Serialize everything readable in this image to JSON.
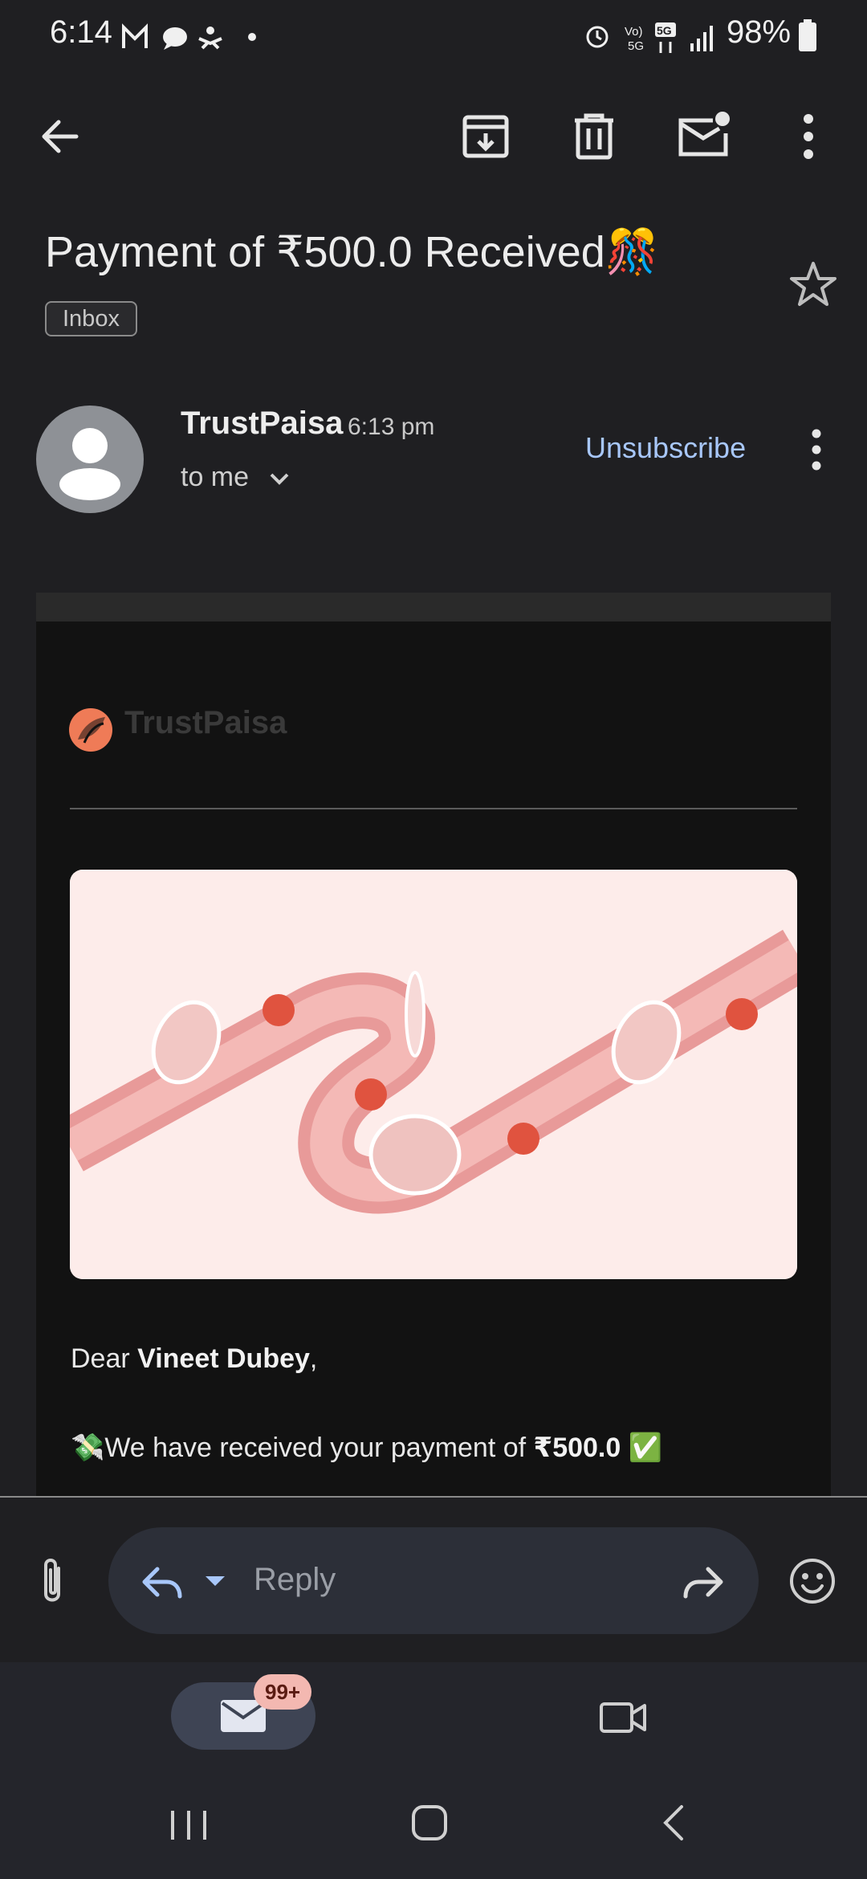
{
  "status_bar": {
    "time": "6:14",
    "battery": "98%"
  },
  "email": {
    "subject": "Payment of ₹500.0 Received🎊",
    "label": "Inbox",
    "sender": "TrustPaisa",
    "time": "6:13 pm",
    "recipient": "to me",
    "unsubscribe": "Unsubscribe",
    "brand": "TrustPaisa",
    "greeting_prefix": "Dear ",
    "customer_name": "Vineet Dubey",
    "greeting_suffix": ",",
    "payment_prefix": "💸We have received your payment of ",
    "payment_amount": "₹500.0",
    "payment_suffix": " ✅"
  },
  "reply_bar": {
    "placeholder": "Reply"
  },
  "bottom_nav": {
    "mail_badge": "99+"
  },
  "colors": {
    "accent": "#a8c7fa",
    "background": "#1f1f22",
    "email_bg": "#121212",
    "badge": "#f3b8b1"
  }
}
